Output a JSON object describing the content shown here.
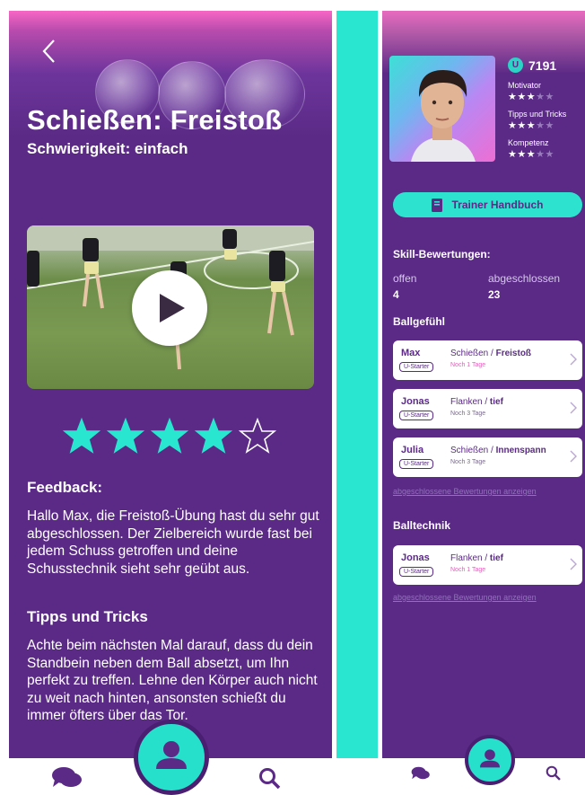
{
  "left": {
    "title": "Schießen: Freistoß",
    "difficulty": "Schwierigkeit: einfach",
    "rating": {
      "value": 4,
      "max": 5
    },
    "feedback_heading": "Feedback:",
    "feedback_text": "Hallo Max, die Freistoß-Übung hast du sehr gut abgeschlossen. Der Zielbereich wurde fast bei jedem Schuss getroffen und deine Schusstechnik sieht sehr geübt aus.",
    "tips_heading": "Tipps und Tricks",
    "tips_text": "Achte beim nächsten Mal darauf, dass du dein Standbein neben dem Ball absetzt, um Ihn perfekt zu treffen. Lehne den Körper auch nicht zu weit nach hinten, ansonsten schießt du immer öfters über das Tor."
  },
  "right": {
    "points": "7191",
    "skills": [
      {
        "label": "Motivator",
        "stars": 3,
        "max": 5
      },
      {
        "label": "Tipps und Tricks",
        "stars": 3,
        "max": 5
      },
      {
        "label": "Kompetenz",
        "stars": 3,
        "max": 5
      }
    ],
    "handbook_label": "Trainer Handbuch",
    "skill_heading": "Skill-Bewertungen:",
    "open_label": "offen",
    "open_value": "4",
    "closed_label": "abgeschlossen",
    "closed_value": "23",
    "group1_heading": "Ballgefühl",
    "group2_heading": "Balltechnik",
    "cards": [
      {
        "name": "Max",
        "badge": "U-Starter",
        "category": "Schießen / ",
        "exercise": "Freistoß",
        "due": "Noch 1 Tage",
        "due_color": "#e85cc0"
      },
      {
        "name": "Jonas",
        "badge": "U-Starter",
        "category": "Flanken / ",
        "exercise": "tief",
        "due": "Noch 3 Tage",
        "due_color": "#7a6a8e"
      },
      {
        "name": "Julia",
        "badge": "U-Starter",
        "category": "Schießen / ",
        "exercise": "Innenspann",
        "due": "Noch 3 Tage",
        "due_color": "#7a6a8e"
      },
      {
        "name": "Jonas",
        "badge": "U-Starter",
        "category": "Flanken / ",
        "exercise": "tief",
        "due": "Noch 1 Tage",
        "due_color": "#e85cc0"
      }
    ],
    "show_completed_label": "abgeschlossene  Bewertungen anzeigen"
  },
  "colors": {
    "primary": "#5b2a86",
    "accent": "#28e6cf",
    "pink": "#e85cc0"
  },
  "icons": [
    "back-arrow-icon",
    "play-icon",
    "star-icon",
    "book-icon",
    "coin-icon",
    "chevron-right-icon",
    "chat-icon",
    "profile-icon",
    "search-icon"
  ]
}
